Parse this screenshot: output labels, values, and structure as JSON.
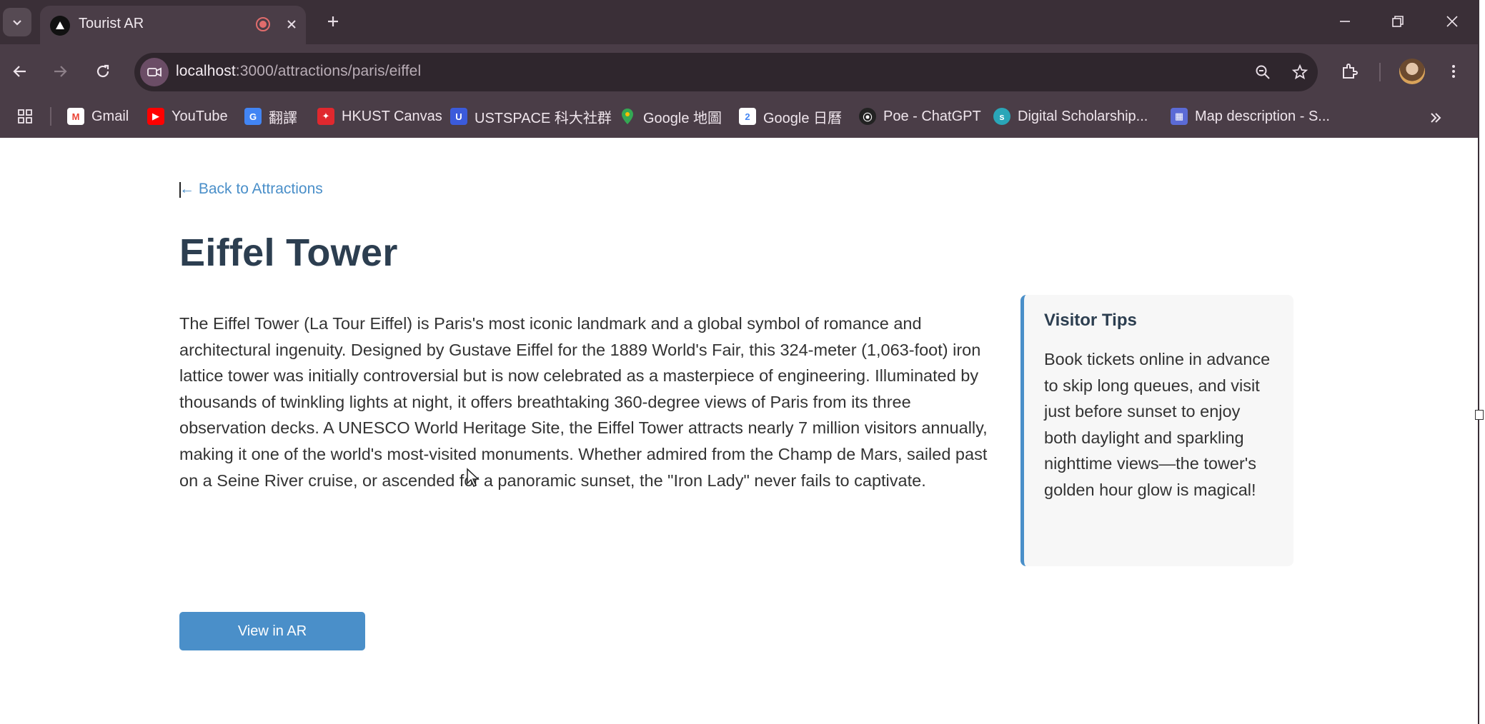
{
  "browser": {
    "tab": {
      "title": "Tourist AR",
      "favicon": "triangle-logo-icon",
      "recording_color": "#e06c6c"
    },
    "url": {
      "host": "localhost",
      "path": ":3000/attractions/paris/eiffel"
    },
    "bookmarks": [
      {
        "label": "Gmail",
        "icon": "gmail-icon",
        "color": "#ea4335"
      },
      {
        "label": "YouTube",
        "icon": "youtube-icon",
        "color": "#ff0000"
      },
      {
        "label": "翻譯",
        "icon": "translate-icon",
        "color": "#4285f4"
      },
      {
        "label": "HKUST Canvas",
        "icon": "canvas-icon",
        "color": "#e0282e"
      },
      {
        "label": "USTSPACE 科大社群",
        "icon": "ustspace-icon",
        "color": "#3b5bdb"
      },
      {
        "label": "Google 地圖",
        "icon": "maps-icon",
        "color": "#34a853"
      },
      {
        "label": "Google 日曆",
        "icon": "calendar-icon",
        "color": "#4285f4"
      },
      {
        "label": "Poe - ChatGPT",
        "icon": "poe-icon",
        "color": "#222222"
      },
      {
        "label": "Digital Scholarship...",
        "icon": "digital-scholarship-icon",
        "color": "#2aa6b8"
      },
      {
        "label": "Map description - S...",
        "icon": "map-description-icon",
        "color": "#5b6bd6"
      }
    ]
  },
  "page": {
    "back_link": "← Back to Attractions",
    "title": "Eiffel Tower",
    "description": "The Eiffel Tower (La Tour Eiffel) is Paris's most iconic landmark and a global symbol of romance and architectural ingenuity. Designed by Gustave Eiffel for the 1889 World's Fair, this 324-meter (1,063-foot) iron lattice tower was initially controversial but is now celebrated as a masterpiece of engineering. Illuminated by thousands of twinkling lights at night, it offers breathtaking 360-degree views of Paris from its three observation decks. A UNESCO World Heritage Site, the Eiffel Tower attracts nearly 7 million visitors annually, making it one of the world's most-visited monuments. Whether admired from the Champ de Mars, sailed past on a Seine River cruise, or ascended for a panoramic sunset, the \"Iron Lady\" never fails to captivate.",
    "tips": {
      "title": "Visitor Tips",
      "text": "Book tickets online in advance to skip long queues, and visit just before sunset to enjoy both daylight and sparkling nighttime views—the tower's golden hour glow is magical!"
    },
    "ar_button": "View in AR",
    "accent_color": "#4a8fc9",
    "heading_color": "#2c3e50"
  }
}
